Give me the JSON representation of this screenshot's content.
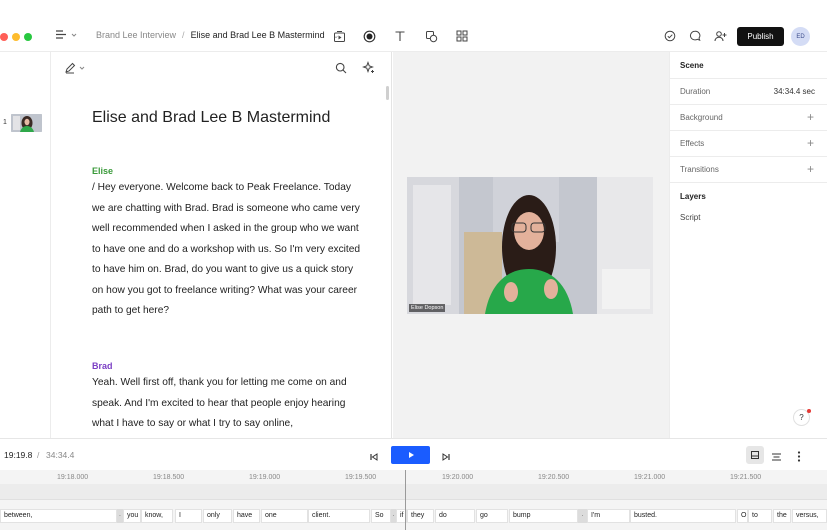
{
  "header": {
    "breadcrumb_prev": "Brand Lee Interview",
    "breadcrumb_sep": "/",
    "breadcrumb_current": "Elise and Brad Lee B Mastermind",
    "publish_label": "Publish",
    "avatar_initials": "ED"
  },
  "scenes": {
    "first_number": "1"
  },
  "script": {
    "title": "Elise and Brad Lee B Mastermind",
    "blocks": [
      {
        "speaker": "Elise",
        "text": "/ Hey everyone. Welcome back to Peak Freelance. Today we are chatting with Brad. Brad is someone who came very well recommended when I asked in the group who we want to have one and do a workshop with us. So I'm very excited to have him on. Brad, do you want to give us a quick story on how you got to freelance writing? What was your career path to get here?"
      },
      {
        "speaker": "Brad",
        "text": "Yeah. Well first off, thank you for letting me come on and speak. And I'm excited to hear that people enjoy hearing what I have to say or what I try to say online,"
      }
    ]
  },
  "preview": {
    "video_label": "Elise Dopson"
  },
  "properties": {
    "scene_title": "Scene",
    "duration_label": "Duration",
    "duration_value": "34:34.4 sec",
    "background_label": "Background",
    "effects_label": "Effects",
    "transitions_label": "Transitions",
    "layers_title": "Layers",
    "layer_script": "Script"
  },
  "help": {
    "label": "?"
  },
  "playback": {
    "current_time": "19:19.8",
    "separator": "/",
    "total_time": "34:34.4"
  },
  "timeline": {
    "ticks": [
      "19:18.000",
      "19:18.500",
      "19:19.000",
      "19:19.500",
      "19:20.000",
      "19:20.500",
      "19:21.000",
      "19:21.500"
    ],
    "words": [
      "between,",
      "you",
      "know,",
      "I",
      "only",
      "have",
      "one",
      "client.",
      "So",
      "if",
      "they",
      "do",
      "go",
      "bump",
      "I'm",
      "busted.",
      "O",
      "to",
      "the",
      "versus,"
    ]
  },
  "colors": {
    "accent": "#1a5cff",
    "publish_bg": "#111111",
    "speaker_elise": "#3a9a3a",
    "speaker_brad": "#7b3fc4"
  },
  "icons": [
    "menu-icon",
    "scene-icon",
    "record-icon",
    "text-icon",
    "shapes-icon",
    "grid-icon",
    "check-circle-icon",
    "comment-icon",
    "add-user-icon",
    "pen-icon",
    "search-icon",
    "sparkle-icon",
    "plus-icon",
    "skip-back-icon",
    "play-icon",
    "skip-forward-icon",
    "layout-icon",
    "align-icon",
    "more-icon"
  ]
}
